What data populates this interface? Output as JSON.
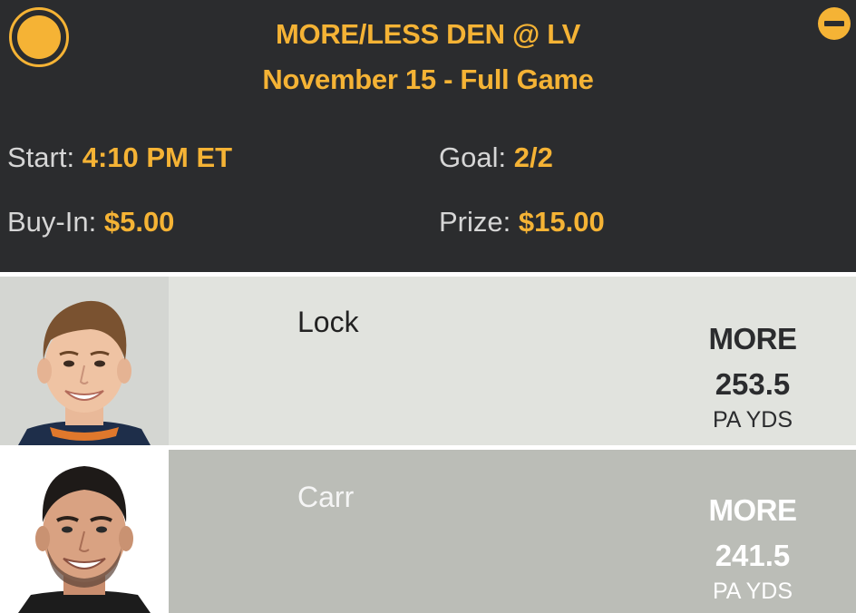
{
  "header": {
    "title_line1": "MORE/LESS DEN @ LV",
    "title_line2": "November 15 - Full Game",
    "start_label": "Start:",
    "start_value": "4:10 PM ET",
    "goal_label": "Goal:",
    "goal_value": "2/2",
    "buyin_label": "Buy-In:",
    "buyin_value": "$5.00",
    "prize_label": "Prize:",
    "prize_value": "$15.00"
  },
  "icons": {
    "select": "radio-selected-icon",
    "collapse": "minus-circle-icon"
  },
  "players": [
    {
      "name": "Lock",
      "pick": "MORE",
      "line": "253.5",
      "stat": "PA YDS"
    },
    {
      "name": "Carr",
      "pick": "MORE",
      "line": "241.5",
      "stat": "PA YDS"
    }
  ],
  "colors": {
    "header_bg": "#2b2c2e",
    "accent": "#f5b335",
    "row1_bg": "#e1e3de",
    "row2_bg": "#bbbdb7"
  }
}
